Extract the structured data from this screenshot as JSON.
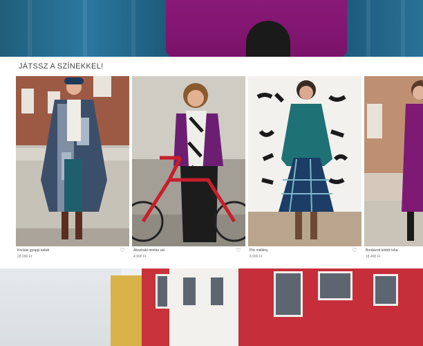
{
  "section": {
    "title": "JÁTSSZ A SZÍNEKKEL!"
  },
  "products": [
    {
      "name": "Kockás gyapjú kabát",
      "price": "28.990 Ft"
    },
    {
      "name": "Absztrakt mintás sál",
      "price": "4.990 Ft"
    },
    {
      "name": "Pliz mellény",
      "price": "6.990 Ft"
    },
    {
      "name": "Bordázott kötött ruha",
      "price": "18.490 Ft"
    }
  ],
  "icons": {
    "favorite": "heart-icon"
  },
  "colors": {
    "accent_magenta": "#8c1a7a",
    "hero_blue": "#2b78a0",
    "wall_red": "#c62e3a"
  }
}
